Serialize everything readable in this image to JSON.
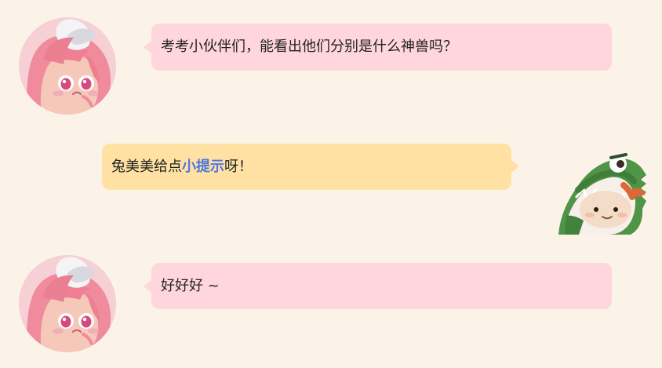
{
  "conversation": {
    "messages": [
      {
        "text": "考考小伙伴们，能看出他们分别是什么神兽吗？"
      },
      {
        "text_before": "兔美美给点",
        "highlight": "小提示",
        "text_after": "呀！"
      },
      {
        "text": "好好好 ~"
      }
    ]
  },
  "colors": {
    "background": "#fbf3e8",
    "pink_bubble": "#ffd6db",
    "yellow_bubble": "#ffe2a3",
    "hint_text": "#4d76e0"
  },
  "icons": {
    "girl_avatar": "girl-character-avatar-icon",
    "dino_avatar": "dinosaur-character-avatar-icon"
  }
}
